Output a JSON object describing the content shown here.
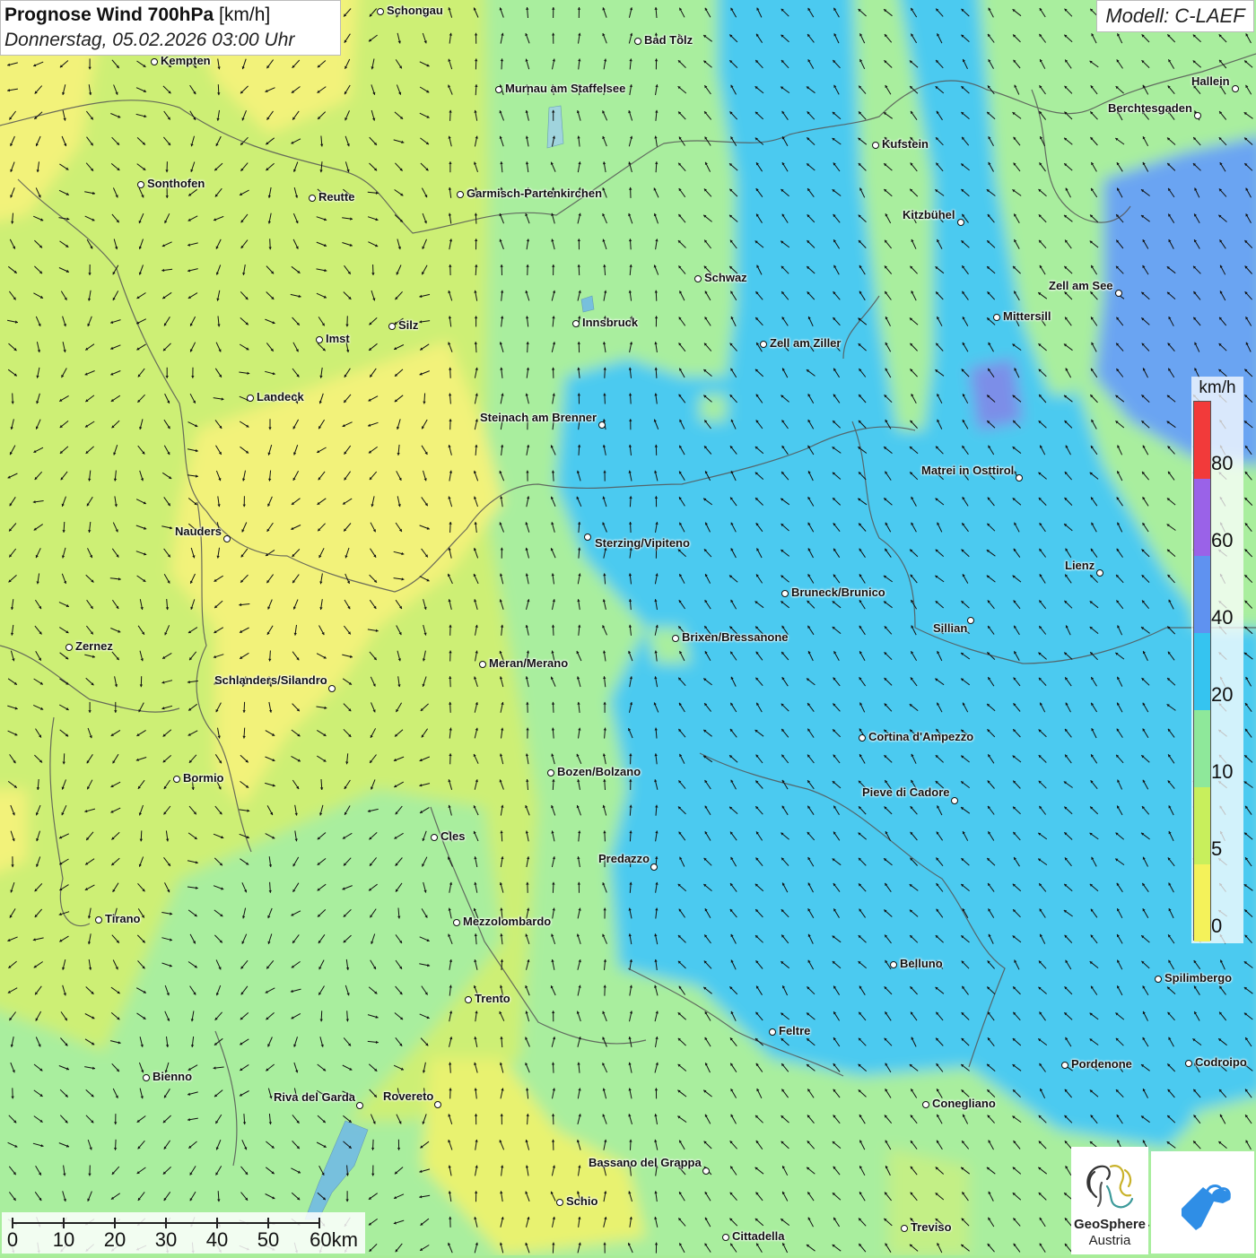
{
  "header": {
    "title_bold": "Prognose Wind 700hPa",
    "title_unit": "[km/h]",
    "datetime": "Donnerstag, 05.02.2026 03:00 Uhr",
    "model": "Modell: C-LAEF"
  },
  "legend": {
    "unit": "km/h",
    "segments": [
      {
        "color": "#f23a3a"
      },
      {
        "color": "#9a62e8"
      },
      {
        "color": "#5f92f0"
      },
      {
        "color": "#35c4f0"
      },
      {
        "color": "#8ee89a"
      },
      {
        "color": "#c8ef5c"
      },
      {
        "color": "#f4f25a"
      }
    ],
    "labels": [
      "80",
      "60",
      "40",
      "20",
      "10",
      "5",
      "0"
    ]
  },
  "scalebar": {
    "labels": [
      "0",
      "10",
      "20",
      "30",
      "40",
      "50",
      "60km"
    ]
  },
  "cities": [
    {
      "name": "Schongau",
      "dot": [
        424,
        13
      ],
      "label": "right"
    },
    {
      "name": "Bad Tölz",
      "dot": [
        711,
        46
      ],
      "label": "right"
    },
    {
      "name": "Kempten",
      "dot": [
        172,
        69
      ],
      "label": "right"
    },
    {
      "name": "Murnau am Staffelsee",
      "dot": [
        556,
        100
      ],
      "label": "right"
    },
    {
      "name": "Hallein",
      "dot": [
        1377,
        99
      ],
      "label": "left"
    },
    {
      "name": "Berchtesgaden",
      "dot": [
        1335,
        129
      ],
      "label": "left"
    },
    {
      "name": "Kufstein",
      "dot": [
        976,
        162
      ],
      "label": "right"
    },
    {
      "name": "Sonthofen",
      "dot": [
        157,
        206
      ],
      "label": "right"
    },
    {
      "name": "Reutte",
      "dot": [
        348,
        221
      ],
      "label": "right"
    },
    {
      "name": "Garmisch-Partenkirchen",
      "dot": [
        513,
        217
      ],
      "label": "right"
    },
    {
      "name": "Kitzbühel",
      "dot": [
        1071,
        248
      ],
      "label": "left"
    },
    {
      "name": "Schwaz",
      "dot": [
        778,
        311
      ],
      "label": "right"
    },
    {
      "name": "Zell am See",
      "dot": [
        1247,
        327
      ],
      "label": "left"
    },
    {
      "name": "Mittersill",
      "dot": [
        1111,
        354
      ],
      "label": "right"
    },
    {
      "name": "Innsbruck",
      "dot": [
        642,
        361
      ],
      "label": "right"
    },
    {
      "name": "Silz",
      "dot": [
        437,
        364
      ],
      "label": "right"
    },
    {
      "name": "Imst",
      "dot": [
        356,
        379
      ],
      "label": "right"
    },
    {
      "name": "Zell am Ziller",
      "dot": [
        851,
        384
      ],
      "label": "right"
    },
    {
      "name": "Landeck",
      "dot": [
        279,
        444
      ],
      "label": "right"
    },
    {
      "name": "Steinach am Brenner",
      "dot": [
        671,
        474
      ],
      "label": "left"
    },
    {
      "name": "Matrei in Osttirol",
      "dot": [
        1136,
        533
      ],
      "label": "left"
    },
    {
      "name": "Nauders",
      "dot": [
        253,
        601
      ],
      "label": "left"
    },
    {
      "name": "Sterzing/Vipiteno",
      "dot": [
        655,
        599
      ],
      "label": "rightdown"
    },
    {
      "name": "Lienz",
      "dot": [
        1226,
        639
      ],
      "label": "left"
    },
    {
      "name": "Bruneck/Brunico",
      "dot": [
        875,
        662
      ],
      "label": "right"
    },
    {
      "name": "Sillian",
      "dot": [
        1082,
        692
      ],
      "label": "leftdown"
    },
    {
      "name": "Brixen/Bressanone",
      "dot": [
        753,
        712
      ],
      "label": "right"
    },
    {
      "name": "Zernez",
      "dot": [
        77,
        722
      ],
      "label": "right"
    },
    {
      "name": "Meran/Merano",
      "dot": [
        538,
        741
      ],
      "label": "right"
    },
    {
      "name": "Schlanders/Silandro",
      "dot": [
        370,
        768
      ],
      "label": "leftup"
    },
    {
      "name": "Cortina d'Ampezzo",
      "dot": [
        961,
        823
      ],
      "label": "right"
    },
    {
      "name": "Bozen/Bolzano",
      "dot": [
        614,
        862
      ],
      "label": "right"
    },
    {
      "name": "Bormio",
      "dot": [
        197,
        869
      ],
      "label": "right"
    },
    {
      "name": "Pieve di Cadore",
      "dot": [
        1064,
        893
      ],
      "label": "leftup"
    },
    {
      "name": "Cles",
      "dot": [
        484,
        934
      ],
      "label": "right"
    },
    {
      "name": "Predazzo",
      "dot": [
        729,
        967
      ],
      "label": "leftup"
    },
    {
      "name": "Tirano",
      "dot": [
        110,
        1026
      ],
      "label": "right"
    },
    {
      "name": "Mezzolombardo",
      "dot": [
        509,
        1029
      ],
      "label": "right"
    },
    {
      "name": "Belluno",
      "dot": [
        996,
        1076
      ],
      "label": "right"
    },
    {
      "name": "Spilimbergo",
      "dot": [
        1291,
        1092
      ],
      "label": "right"
    },
    {
      "name": "Trento",
      "dot": [
        522,
        1115
      ],
      "label": "right"
    },
    {
      "name": "Feltre",
      "dot": [
        861,
        1151
      ],
      "label": "right"
    },
    {
      "name": "Pordenone",
      "dot": [
        1187,
        1188
      ],
      "label": "right"
    },
    {
      "name": "Codroipo",
      "dot": [
        1325,
        1186
      ],
      "label": "right"
    },
    {
      "name": "Bienno",
      "dot": [
        163,
        1202
      ],
      "label": "right"
    },
    {
      "name": "Riva del Garda",
      "dot": [
        401,
        1233
      ],
      "label": "leftup"
    },
    {
      "name": "Rovereto",
      "dot": [
        488,
        1232
      ],
      "label": "leftup"
    },
    {
      "name": "Conegliano",
      "dot": [
        1032,
        1232
      ],
      "label": "right"
    },
    {
      "name": "Bassano del Grappa",
      "dot": [
        787,
        1306
      ],
      "label": "leftup"
    },
    {
      "name": "Schio",
      "dot": [
        624,
        1341
      ],
      "label": "right"
    },
    {
      "name": "Treviso",
      "dot": [
        1008,
        1370
      ],
      "label": "right"
    },
    {
      "name": "Cittadella",
      "dot": [
        809,
        1380
      ],
      "label": "right"
    }
  ],
  "logos": {
    "geosphere_name": "GeoSphere",
    "geosphere_sub": "Austria"
  },
  "colors": {
    "yellow": "#f2f27a",
    "yellowgreen": "#cdef74",
    "green": "#a9ee9e",
    "cyan": "#4ccaf0",
    "blue": "#6aa4f2",
    "purple": "#8c7fe8",
    "border": "#555555",
    "brand_blue": "#2f8ee6"
  }
}
